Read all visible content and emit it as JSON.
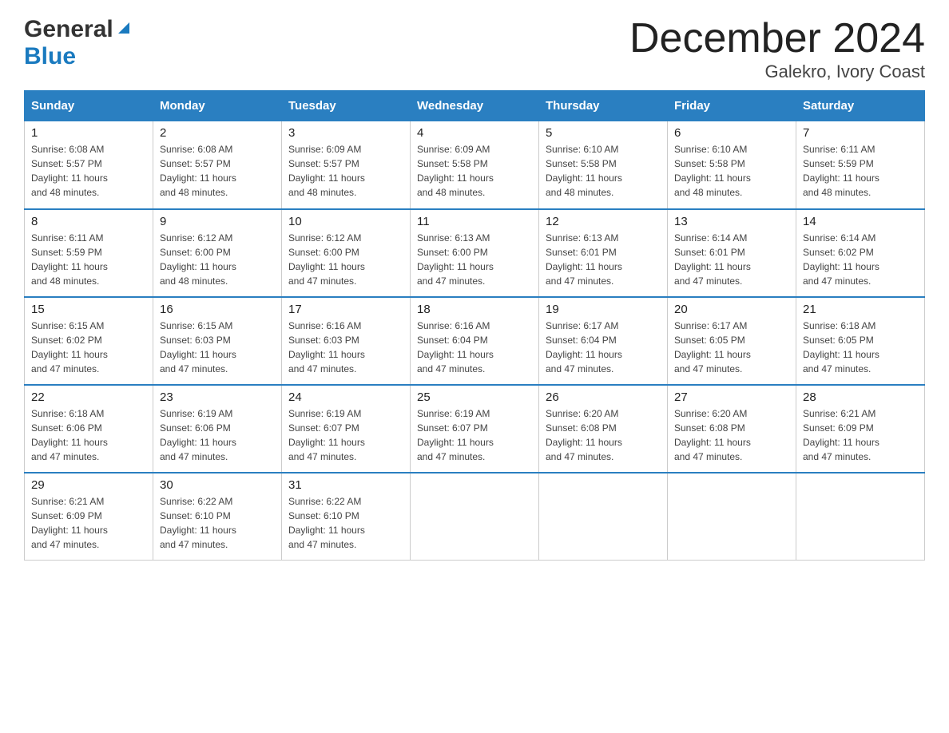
{
  "header": {
    "logo_general": "General",
    "logo_blue": "Blue",
    "title": "December 2024",
    "subtitle": "Galekro, Ivory Coast"
  },
  "days_of_week": [
    "Sunday",
    "Monday",
    "Tuesday",
    "Wednesday",
    "Thursday",
    "Friday",
    "Saturday"
  ],
  "weeks": [
    [
      {
        "day": "1",
        "sunrise": "6:08 AM",
        "sunset": "5:57 PM",
        "daylight": "11 hours and 48 minutes."
      },
      {
        "day": "2",
        "sunrise": "6:08 AM",
        "sunset": "5:57 PM",
        "daylight": "11 hours and 48 minutes."
      },
      {
        "day": "3",
        "sunrise": "6:09 AM",
        "sunset": "5:57 PM",
        "daylight": "11 hours and 48 minutes."
      },
      {
        "day": "4",
        "sunrise": "6:09 AM",
        "sunset": "5:58 PM",
        "daylight": "11 hours and 48 minutes."
      },
      {
        "day": "5",
        "sunrise": "6:10 AM",
        "sunset": "5:58 PM",
        "daylight": "11 hours and 48 minutes."
      },
      {
        "day": "6",
        "sunrise": "6:10 AM",
        "sunset": "5:58 PM",
        "daylight": "11 hours and 48 minutes."
      },
      {
        "day": "7",
        "sunrise": "6:11 AM",
        "sunset": "5:59 PM",
        "daylight": "11 hours and 48 minutes."
      }
    ],
    [
      {
        "day": "8",
        "sunrise": "6:11 AM",
        "sunset": "5:59 PM",
        "daylight": "11 hours and 48 minutes."
      },
      {
        "day": "9",
        "sunrise": "6:12 AM",
        "sunset": "6:00 PM",
        "daylight": "11 hours and 48 minutes."
      },
      {
        "day": "10",
        "sunrise": "6:12 AM",
        "sunset": "6:00 PM",
        "daylight": "11 hours and 47 minutes."
      },
      {
        "day": "11",
        "sunrise": "6:13 AM",
        "sunset": "6:00 PM",
        "daylight": "11 hours and 47 minutes."
      },
      {
        "day": "12",
        "sunrise": "6:13 AM",
        "sunset": "6:01 PM",
        "daylight": "11 hours and 47 minutes."
      },
      {
        "day": "13",
        "sunrise": "6:14 AM",
        "sunset": "6:01 PM",
        "daylight": "11 hours and 47 minutes."
      },
      {
        "day": "14",
        "sunrise": "6:14 AM",
        "sunset": "6:02 PM",
        "daylight": "11 hours and 47 minutes."
      }
    ],
    [
      {
        "day": "15",
        "sunrise": "6:15 AM",
        "sunset": "6:02 PM",
        "daylight": "11 hours and 47 minutes."
      },
      {
        "day": "16",
        "sunrise": "6:15 AM",
        "sunset": "6:03 PM",
        "daylight": "11 hours and 47 minutes."
      },
      {
        "day": "17",
        "sunrise": "6:16 AM",
        "sunset": "6:03 PM",
        "daylight": "11 hours and 47 minutes."
      },
      {
        "day": "18",
        "sunrise": "6:16 AM",
        "sunset": "6:04 PM",
        "daylight": "11 hours and 47 minutes."
      },
      {
        "day": "19",
        "sunrise": "6:17 AM",
        "sunset": "6:04 PM",
        "daylight": "11 hours and 47 minutes."
      },
      {
        "day": "20",
        "sunrise": "6:17 AM",
        "sunset": "6:05 PM",
        "daylight": "11 hours and 47 minutes."
      },
      {
        "day": "21",
        "sunrise": "6:18 AM",
        "sunset": "6:05 PM",
        "daylight": "11 hours and 47 minutes."
      }
    ],
    [
      {
        "day": "22",
        "sunrise": "6:18 AM",
        "sunset": "6:06 PM",
        "daylight": "11 hours and 47 minutes."
      },
      {
        "day": "23",
        "sunrise": "6:19 AM",
        "sunset": "6:06 PM",
        "daylight": "11 hours and 47 minutes."
      },
      {
        "day": "24",
        "sunrise": "6:19 AM",
        "sunset": "6:07 PM",
        "daylight": "11 hours and 47 minutes."
      },
      {
        "day": "25",
        "sunrise": "6:19 AM",
        "sunset": "6:07 PM",
        "daylight": "11 hours and 47 minutes."
      },
      {
        "day": "26",
        "sunrise": "6:20 AM",
        "sunset": "6:08 PM",
        "daylight": "11 hours and 47 minutes."
      },
      {
        "day": "27",
        "sunrise": "6:20 AM",
        "sunset": "6:08 PM",
        "daylight": "11 hours and 47 minutes."
      },
      {
        "day": "28",
        "sunrise": "6:21 AM",
        "sunset": "6:09 PM",
        "daylight": "11 hours and 47 minutes."
      }
    ],
    [
      {
        "day": "29",
        "sunrise": "6:21 AM",
        "sunset": "6:09 PM",
        "daylight": "11 hours and 47 minutes."
      },
      {
        "day": "30",
        "sunrise": "6:22 AM",
        "sunset": "6:10 PM",
        "daylight": "11 hours and 47 minutes."
      },
      {
        "day": "31",
        "sunrise": "6:22 AM",
        "sunset": "6:10 PM",
        "daylight": "11 hours and 47 minutes."
      },
      null,
      null,
      null,
      null
    ]
  ],
  "labels": {
    "sunrise": "Sunrise:",
    "sunset": "Sunset:",
    "daylight": "Daylight:"
  }
}
